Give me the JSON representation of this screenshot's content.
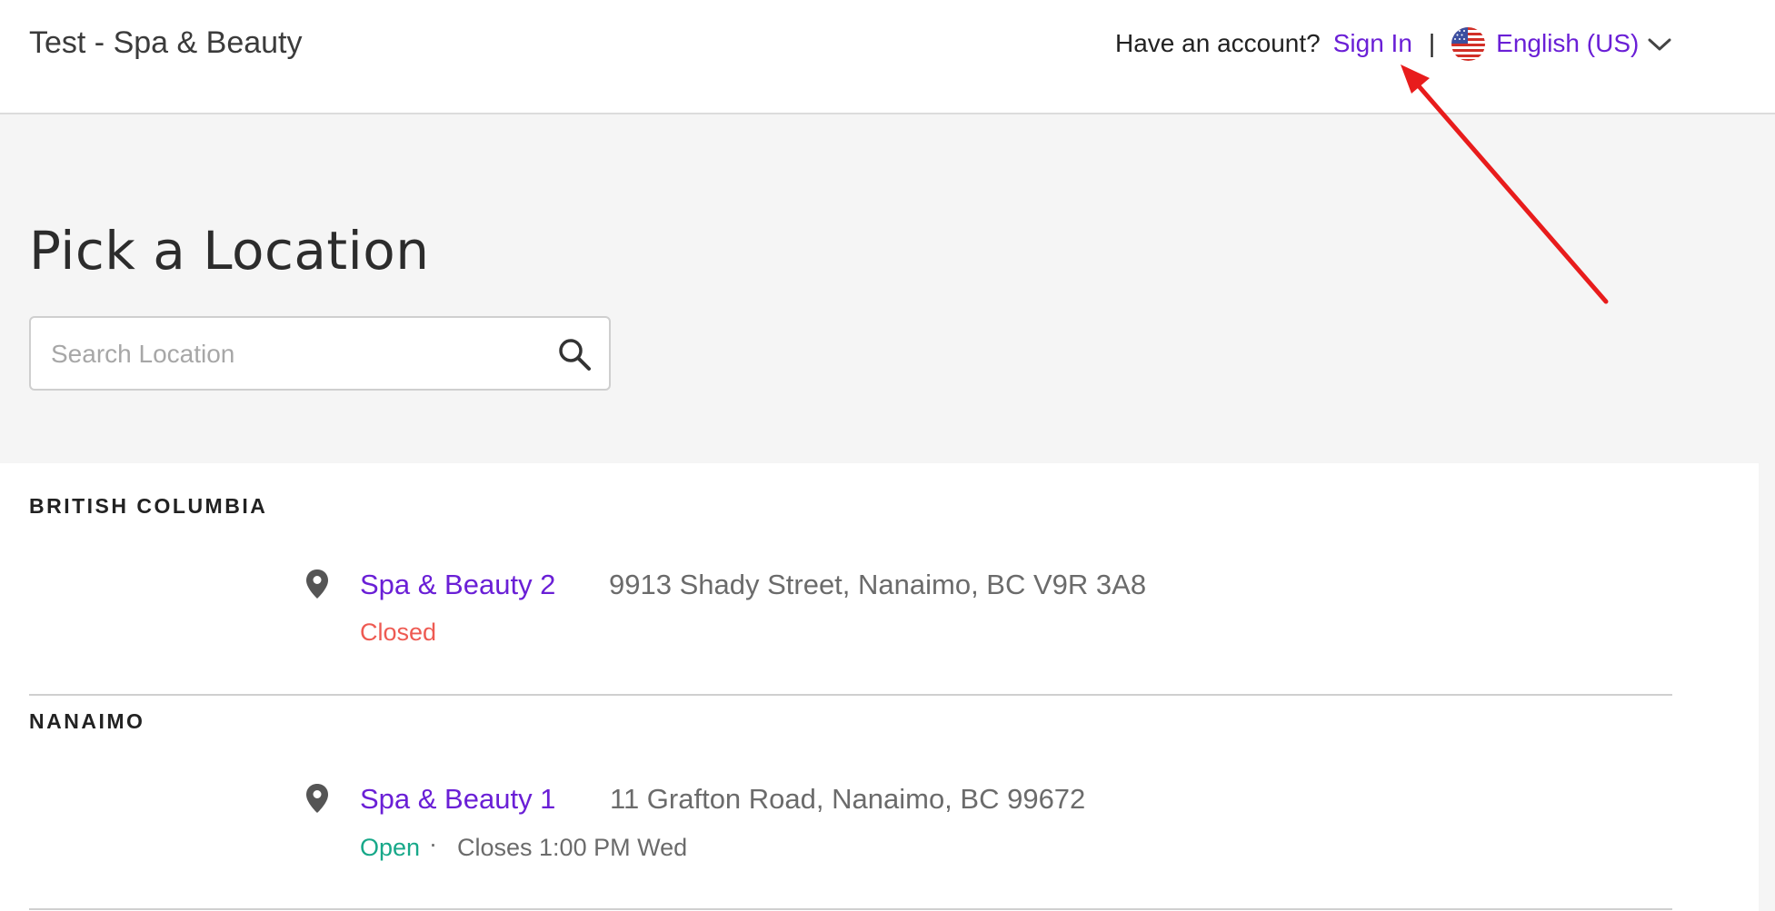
{
  "header": {
    "brand": "Test - Spa & Beauty",
    "account_prompt": "Have an account?",
    "sign_in": "Sign In",
    "separator": "|",
    "language": "English (US)",
    "flag_icon": "us-flag-icon",
    "language_chevron_icon": "chevron-down-icon"
  },
  "main": {
    "title": "Pick a Location",
    "search": {
      "placeholder": "Search Location",
      "value": "",
      "icon": "search-icon"
    }
  },
  "regions": [
    {
      "name": "BRITISH COLUMBIA",
      "locations": [
        {
          "name": "Spa & Beauty 2",
          "address": "9913 Shady Street, Nanaimo, BC V9R 3A8",
          "status": "Closed"
        }
      ]
    },
    {
      "name": "NANAIMO",
      "locations": [
        {
          "name": "Spa & Beauty 1",
          "address": "11 Grafton Road, Nanaimo, BC 99672",
          "status": "Open",
          "separator": "·",
          "hours": "Closes 1:00 PM Wed"
        }
      ]
    }
  ],
  "colors": {
    "accent": "#6a1fd6",
    "closed": "#ee5a52",
    "open": "#17a889",
    "annotation_arrow": "#e81c1c"
  }
}
